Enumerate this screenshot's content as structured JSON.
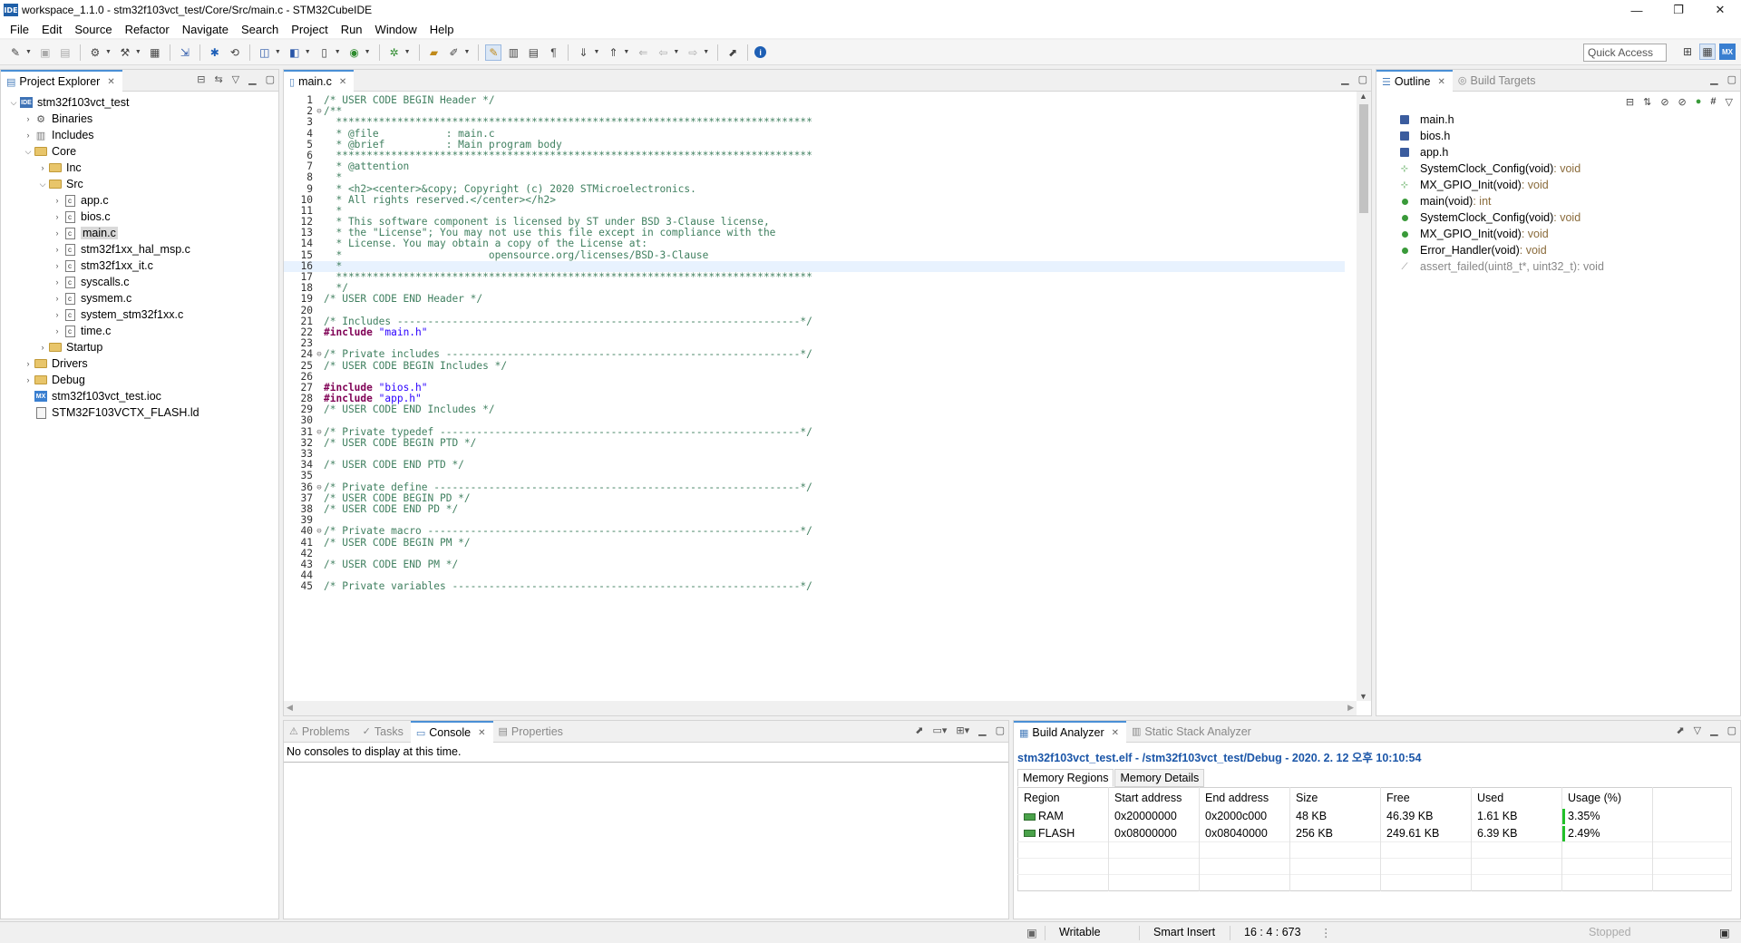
{
  "window": {
    "app_icon": "IDE",
    "title": "workspace_1.1.0 - stm32f103vct_test/Core/Src/main.c - STM32CubeIDE",
    "controls": [
      "—",
      "❐",
      "✕"
    ]
  },
  "menu": [
    "File",
    "Edit",
    "Source",
    "Refactor",
    "Navigate",
    "Search",
    "Project",
    "Run",
    "Window",
    "Help"
  ],
  "toolbar": {
    "quick_access": "Quick Access",
    "right_badge": "MX"
  },
  "project_explorer": {
    "title": "Project Explorer",
    "tree": [
      {
        "label": "stm32f103vct_test",
        "depth": 0,
        "twisty": "open",
        "icon": "project-icon"
      },
      {
        "label": "Binaries",
        "depth": 1,
        "twisty": "closed",
        "icon": "binaries-icon"
      },
      {
        "label": "Includes",
        "depth": 1,
        "twisty": "closed",
        "icon": "includes-icon"
      },
      {
        "label": "Core",
        "depth": 1,
        "twisty": "open",
        "icon": "folder-icon"
      },
      {
        "label": "Inc",
        "depth": 2,
        "twisty": "closed",
        "icon": "folder-icon"
      },
      {
        "label": "Src",
        "depth": 2,
        "twisty": "open",
        "icon": "folder-icon"
      },
      {
        "label": "app.c",
        "depth": 3,
        "twisty": "closed",
        "icon": "c-file-icon"
      },
      {
        "label": "bios.c",
        "depth": 3,
        "twisty": "closed",
        "icon": "c-file-icon"
      },
      {
        "label": "main.c",
        "depth": 3,
        "twisty": "closed",
        "icon": "c-file-icon",
        "selected": true
      },
      {
        "label": "stm32f1xx_hal_msp.c",
        "depth": 3,
        "twisty": "closed",
        "icon": "c-file-icon"
      },
      {
        "label": "stm32f1xx_it.c",
        "depth": 3,
        "twisty": "closed",
        "icon": "c-file-icon"
      },
      {
        "label": "syscalls.c",
        "depth": 3,
        "twisty": "closed",
        "icon": "c-file-icon"
      },
      {
        "label": "sysmem.c",
        "depth": 3,
        "twisty": "closed",
        "icon": "c-file-icon"
      },
      {
        "label": "system_stm32f1xx.c",
        "depth": 3,
        "twisty": "closed",
        "icon": "c-file-icon"
      },
      {
        "label": "time.c",
        "depth": 3,
        "twisty": "closed",
        "icon": "c-file-icon"
      },
      {
        "label": "Startup",
        "depth": 2,
        "twisty": "closed",
        "icon": "folder-icon"
      },
      {
        "label": "Drivers",
        "depth": 1,
        "twisty": "closed",
        "icon": "folder-icon"
      },
      {
        "label": "Debug",
        "depth": 1,
        "twisty": "closed",
        "icon": "folder-icon"
      },
      {
        "label": "stm32f103vct_test.ioc",
        "depth": 1,
        "twisty": "none",
        "icon": "mx-file-icon"
      },
      {
        "label": "STM32F103VCTX_FLASH.ld",
        "depth": 1,
        "twisty": "none",
        "icon": "ld-file-icon"
      }
    ]
  },
  "editor": {
    "tab_label": "main.c",
    "current_line": 16,
    "lines": [
      {
        "n": "1",
        "fold": "",
        "t": "/* USER CODE BEGIN Header */",
        "k": "ct"
      },
      {
        "n": "2",
        "fold": "⊖",
        "t": "/**",
        "k": "ct"
      },
      {
        "n": "3",
        "fold": "",
        "t": "  ******************************************************************************",
        "k": "ct"
      },
      {
        "n": "4",
        "fold": "",
        "t": "  * @file           : main.c",
        "k": "ct"
      },
      {
        "n": "5",
        "fold": "",
        "t": "  * @brief          : Main program body",
        "k": "ct"
      },
      {
        "n": "6",
        "fold": "",
        "t": "  ******************************************************************************",
        "k": "ct"
      },
      {
        "n": "7",
        "fold": "",
        "t": "  * @attention",
        "k": "ct"
      },
      {
        "n": "8",
        "fold": "",
        "t": "  *",
        "k": "ct"
      },
      {
        "n": "9",
        "fold": "",
        "t": "  * <h2><center>&copy; Copyright (c) 2020 STMicroelectronics.",
        "k": "ct"
      },
      {
        "n": "10",
        "fold": "",
        "t": "  * All rights reserved.</center></h2>",
        "k": "ct"
      },
      {
        "n": "11",
        "fold": "",
        "t": "  *",
        "k": "ct"
      },
      {
        "n": "12",
        "fold": "",
        "t": "  * This software component is licensed by ST under BSD 3-Clause license,",
        "k": "ct"
      },
      {
        "n": "13",
        "fold": "",
        "t": "  * the \"License\"; You may not use this file except in compliance with the",
        "k": "ct"
      },
      {
        "n": "14",
        "fold": "",
        "t": "  * License. You may obtain a copy of the License at:",
        "k": "ct"
      },
      {
        "n": "15",
        "fold": "",
        "t": "  *                        opensource.org/licenses/BSD-3-Clause",
        "k": "ct"
      },
      {
        "n": "16",
        "fold": "",
        "t": "  *",
        "k": "ct"
      },
      {
        "n": "17",
        "fold": "",
        "t": "  ******************************************************************************",
        "k": "ct"
      },
      {
        "n": "18",
        "fold": "",
        "t": "  */",
        "k": "ct"
      },
      {
        "n": "19",
        "fold": "",
        "t": "/* USER CODE END Header */",
        "k": "ct"
      },
      {
        "n": "20",
        "fold": "",
        "t": "",
        "k": "ct"
      },
      {
        "n": "21",
        "fold": "",
        "t": "/* Includes ------------------------------------------------------------------*/",
        "k": "ct"
      },
      {
        "n": "22",
        "fold": "",
        "t": "#include",
        "k": "kw",
        "t2": " \"main.h\"",
        "k2": "st"
      },
      {
        "n": "23",
        "fold": "",
        "t": "",
        "k": "ct"
      },
      {
        "n": "24",
        "fold": "⊖",
        "t": "/* Private includes ----------------------------------------------------------*/",
        "k": "ct"
      },
      {
        "n": "25",
        "fold": "",
        "t": "/* USER CODE BEGIN Includes */",
        "k": "ct"
      },
      {
        "n": "26",
        "fold": "",
        "t": "",
        "k": "ct"
      },
      {
        "n": "27",
        "fold": "",
        "t": "#include",
        "k": "kw",
        "t2": " \"bios.h\"",
        "k2": "st"
      },
      {
        "n": "28",
        "fold": "",
        "t": "#include",
        "k": "kw",
        "t2": " \"app.h\"",
        "k2": "st"
      },
      {
        "n": "29",
        "fold": "",
        "t": "/* USER CODE END Includes */",
        "k": "ct"
      },
      {
        "n": "30",
        "fold": "",
        "t": "",
        "k": "ct"
      },
      {
        "n": "31",
        "fold": "⊖",
        "t": "/* Private typedef -----------------------------------------------------------*/",
        "k": "ct"
      },
      {
        "n": "32",
        "fold": "",
        "t": "/* USER CODE BEGIN PTD */",
        "k": "ct"
      },
      {
        "n": "33",
        "fold": "",
        "t": "",
        "k": "ct"
      },
      {
        "n": "34",
        "fold": "",
        "t": "/* USER CODE END PTD */",
        "k": "ct"
      },
      {
        "n": "35",
        "fold": "",
        "t": "",
        "k": "ct"
      },
      {
        "n": "36",
        "fold": "⊖",
        "t": "/* Private define ------------------------------------------------------------*/",
        "k": "ct"
      },
      {
        "n": "37",
        "fold": "",
        "t": "/* USER CODE BEGIN PD */",
        "k": "ct"
      },
      {
        "n": "38",
        "fold": "",
        "t": "/* USER CODE END PD */",
        "k": "ct"
      },
      {
        "n": "39",
        "fold": "",
        "t": "",
        "k": "ct"
      },
      {
        "n": "40",
        "fold": "⊖",
        "t": "/* Private macro -------------------------------------------------------------*/",
        "k": "ct"
      },
      {
        "n": "41",
        "fold": "",
        "t": "/* USER CODE BEGIN PM */",
        "k": "ct"
      },
      {
        "n": "42",
        "fold": "",
        "t": "",
        "k": "ct"
      },
      {
        "n": "43",
        "fold": "",
        "t": "/* USER CODE END PM */",
        "k": "ct"
      },
      {
        "n": "44",
        "fold": "",
        "t": "",
        "k": "ct"
      },
      {
        "n": "45",
        "fold": "",
        "t": "/* Private variables ---------------------------------------------------------*/",
        "k": "ct"
      }
    ]
  },
  "outline": {
    "tab_label": "Outline",
    "other_tab": "Build Targets",
    "items": [
      {
        "name": "main.h",
        "ret": "",
        "icon": "header-icon"
      },
      {
        "name": "bios.h",
        "ret": "",
        "icon": "header-icon"
      },
      {
        "name": "app.h",
        "ret": "",
        "icon": "header-icon"
      },
      {
        "name": "SystemClock_Config(void)",
        "ret": " : void",
        "icon": "declaration-icon"
      },
      {
        "name": "MX_GPIO_Init(void)",
        "ret": " : void",
        "icon": "static-declaration-icon"
      },
      {
        "name": "main(void)",
        "ret": " : int",
        "icon": "function-icon"
      },
      {
        "name": "SystemClock_Config(void)",
        "ret": " : void",
        "icon": "function-icon"
      },
      {
        "name": "MX_GPIO_Init(void)",
        "ret": " : void",
        "icon": "static-function-icon"
      },
      {
        "name": "Error_Handler(void)",
        "ret": " : void",
        "icon": "function-icon"
      },
      {
        "name": "assert_failed(uint8_t*, uint32_t)",
        "ret": " : void",
        "icon": "inactive-function-icon",
        "greyed": true
      }
    ]
  },
  "bottom_left": {
    "tabs": [
      "Problems",
      "Tasks",
      "Console",
      "Properties"
    ],
    "active": "Console",
    "console_message": "No consoles to display at this time."
  },
  "build_analyzer": {
    "tab_label": "Build Analyzer",
    "other_tab": "Static Stack Analyzer",
    "title": "stm32f103vct_test.elf - /stm32f103vct_test/Debug - 2020. 2. 12 오후 10:10:54",
    "subtabs": [
      "Memory Regions",
      "Memory Details"
    ],
    "columns": [
      "Region",
      "Start address",
      "End address",
      "Size",
      "Free",
      "Used",
      "Usage (%)"
    ],
    "rows": [
      {
        "region": "RAM",
        "start": "0x20000000",
        "end": "0x2000c000",
        "size": "48 KB",
        "free": "46.39 KB",
        "used": "1.61 KB",
        "usage": "3.35%"
      },
      {
        "region": "FLASH",
        "start": "0x08000000",
        "end": "0x08040000",
        "size": "256 KB",
        "free": "249.61 KB",
        "used": "6.39 KB",
        "usage": "2.49%"
      }
    ]
  },
  "statusbar": {
    "writable": "Writable",
    "insert_mode": "Smart Insert",
    "position": "16 : 4 : 673",
    "progress": "Stopped"
  }
}
